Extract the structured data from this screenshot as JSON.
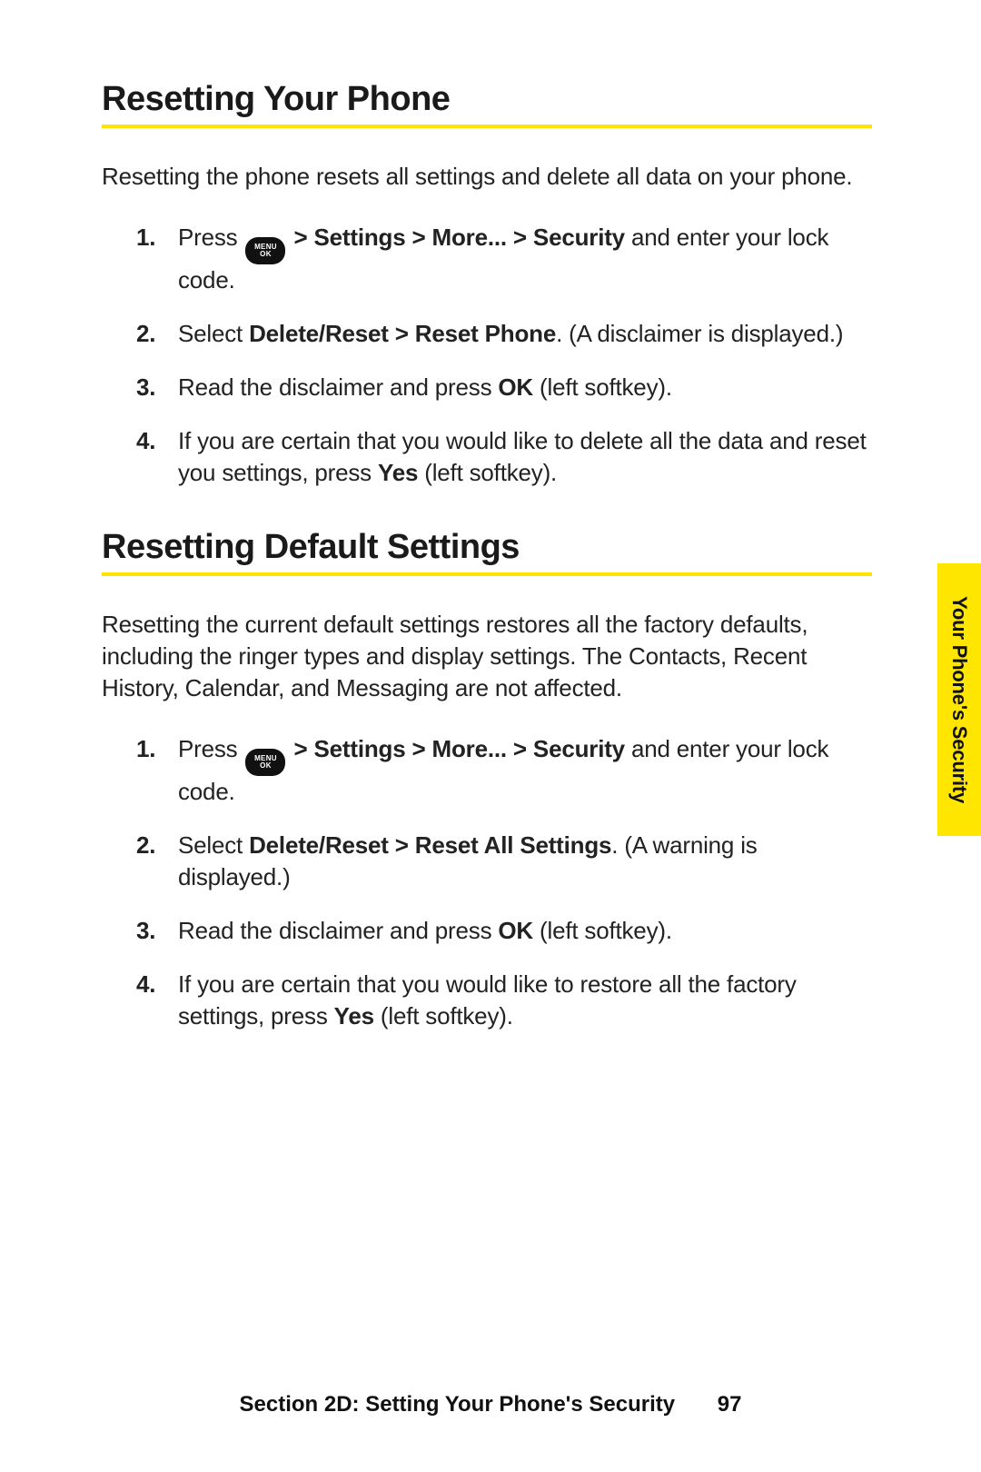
{
  "tab_label": "Your Phone's Security",
  "menu_key": {
    "line1": "MENU",
    "line2": "OK"
  },
  "section1": {
    "heading": "Resetting Your Phone",
    "intro": "Resetting the phone resets all settings and delete all data on your phone.",
    "steps": [
      {
        "n": "1.",
        "pre": "Press ",
        "has_key": true,
        "mid_bold": " > Settings > More... > Security",
        "post": " and enter your lock code."
      },
      {
        "n": "2.",
        "pre": "Select ",
        "mid_bold": "Delete/Reset > Reset Phone",
        "post": ". (A disclaimer is displayed.)"
      },
      {
        "n": "3.",
        "pre": "Read the disclaimer and press ",
        "mid_bold": "OK",
        "post": " (left softkey)."
      },
      {
        "n": "4.",
        "pre": "If you are certain that you would like to delete all the data and reset you settings, press ",
        "mid_bold": "Yes",
        "post": " (left softkey)."
      }
    ]
  },
  "section2": {
    "heading": "Resetting Default Settings",
    "intro": "Resetting the current default settings restores all the factory defaults, including the ringer types and display settings. The Contacts, Recent History, Calendar, and Messaging are not affected.",
    "steps": [
      {
        "n": "1.",
        "pre": "Press ",
        "has_key": true,
        "mid_bold": " > Settings > More... > Security",
        "post": " and enter your lock code."
      },
      {
        "n": "2.",
        "pre": "Select ",
        "mid_bold": "Delete/Reset > Reset All Settings",
        "post": ". (A warning is displayed.)"
      },
      {
        "n": "3.",
        "pre": "Read the disclaimer and press ",
        "mid_bold": "OK",
        "post": " (left softkey)."
      },
      {
        "n": "4.",
        "pre": "If you are certain that you would like to restore all the factory settings, press ",
        "mid_bold": "Yes",
        "post": " (left softkey)."
      }
    ]
  },
  "footer": {
    "section_label": "Section 2D: Setting Your Phone's Security",
    "page": "97"
  }
}
